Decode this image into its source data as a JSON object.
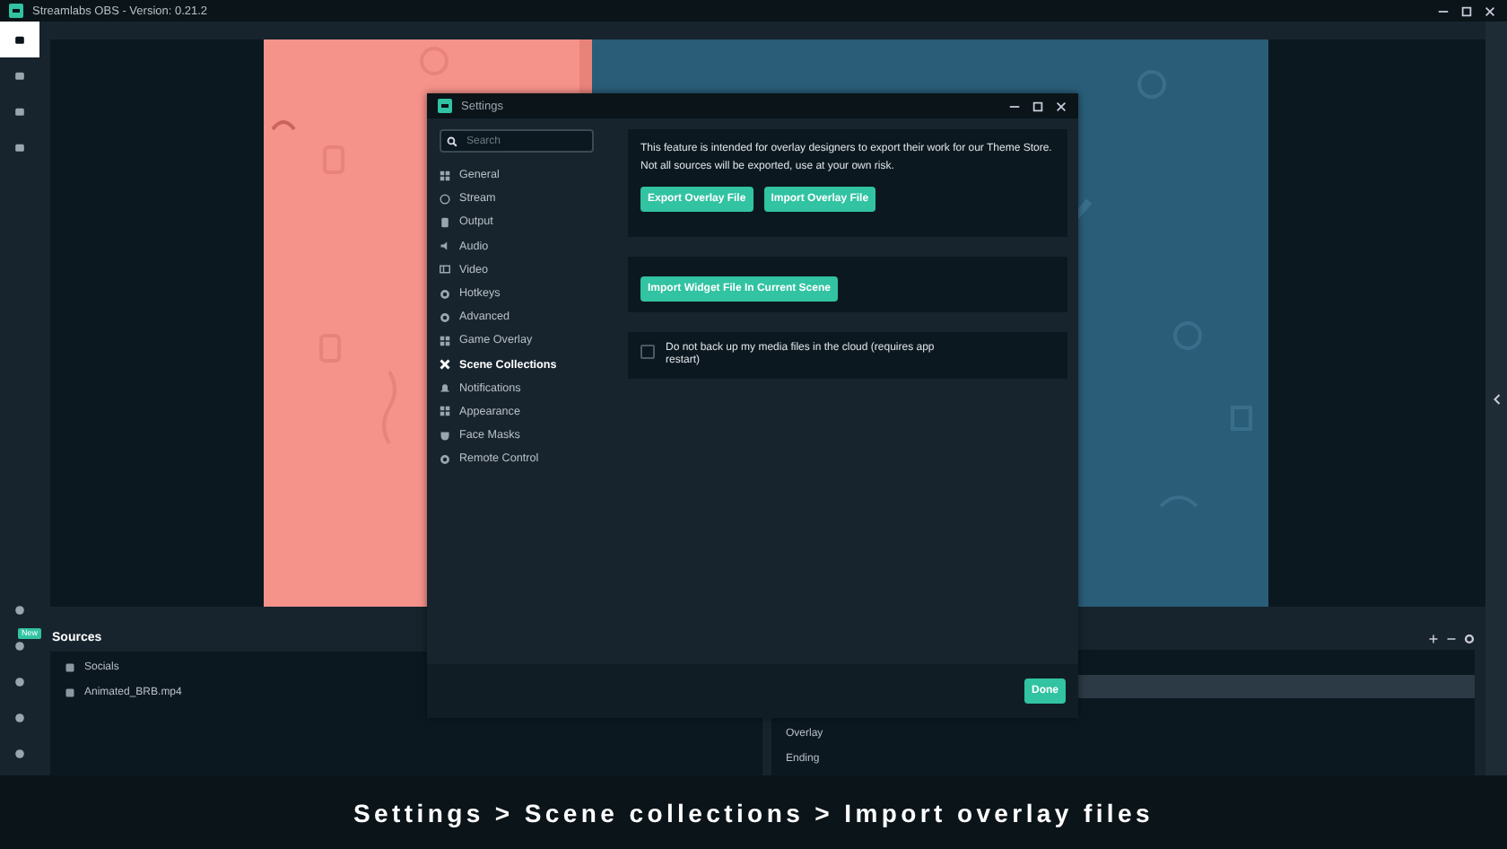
{
  "window": {
    "title": "Streamlabs OBS - Version: 0.21.2"
  },
  "app_nav": {
    "top": [
      {
        "selected": true
      },
      {
        "selected": false
      },
      {
        "selected": false
      },
      {
        "selected": false
      }
    ],
    "bottom": [
      {
        "selected": false
      },
      {
        "selected": false,
        "badge": "New"
      },
      {
        "selected": false
      },
      {
        "selected": false
      },
      {
        "selected": false
      }
    ]
  },
  "sources": {
    "title": "Sources",
    "items": [
      {
        "label": "Socials",
        "selected": false
      },
      {
        "label": "Animated_BRB.mp4",
        "selected": false
      }
    ]
  },
  "scenes": {
    "rows": [
      {
        "selected": false
      },
      {
        "selected": true
      },
      {
        "selected": false
      },
      {
        "label": "Overlay",
        "selected": false
      },
      {
        "label": "Ending",
        "selected": false
      }
    ]
  },
  "settings": {
    "title": "Settings",
    "search": {
      "placeholder": "Search"
    },
    "nav": [
      {
        "label": "General",
        "selected": false
      },
      {
        "label": "Stream",
        "selected": false
      },
      {
        "label": "Output",
        "selected": false
      },
      {
        "label": "Audio",
        "selected": false
      },
      {
        "label": "Video",
        "selected": false
      },
      {
        "label": "Hotkeys",
        "selected": false
      },
      {
        "label": "Advanced",
        "selected": false
      },
      {
        "label": "Game Overlay",
        "selected": false
      },
      {
        "label": "Scene Collections",
        "selected": true
      },
      {
        "label": "Notifications",
        "selected": false
      },
      {
        "label": "Appearance",
        "selected": false
      },
      {
        "label": "Face Masks",
        "selected": false
      },
      {
        "label": "Remote Control",
        "selected": false
      }
    ],
    "description": "This feature is intended for overlay designers to export their work for our Theme Store. Not all sources will be exported, use at your own risk.",
    "overlay_buttons": [
      "Export Overlay File",
      "Import Overlay File"
    ],
    "widget_button": "Import Widget File In Current Scene",
    "backup_option": {
      "label": "Do not back up my media files in the cloud (requires app restart)",
      "checked": false
    },
    "done_button": "Done"
  },
  "caption": "Settings > Scene collections > Import overlay files"
}
